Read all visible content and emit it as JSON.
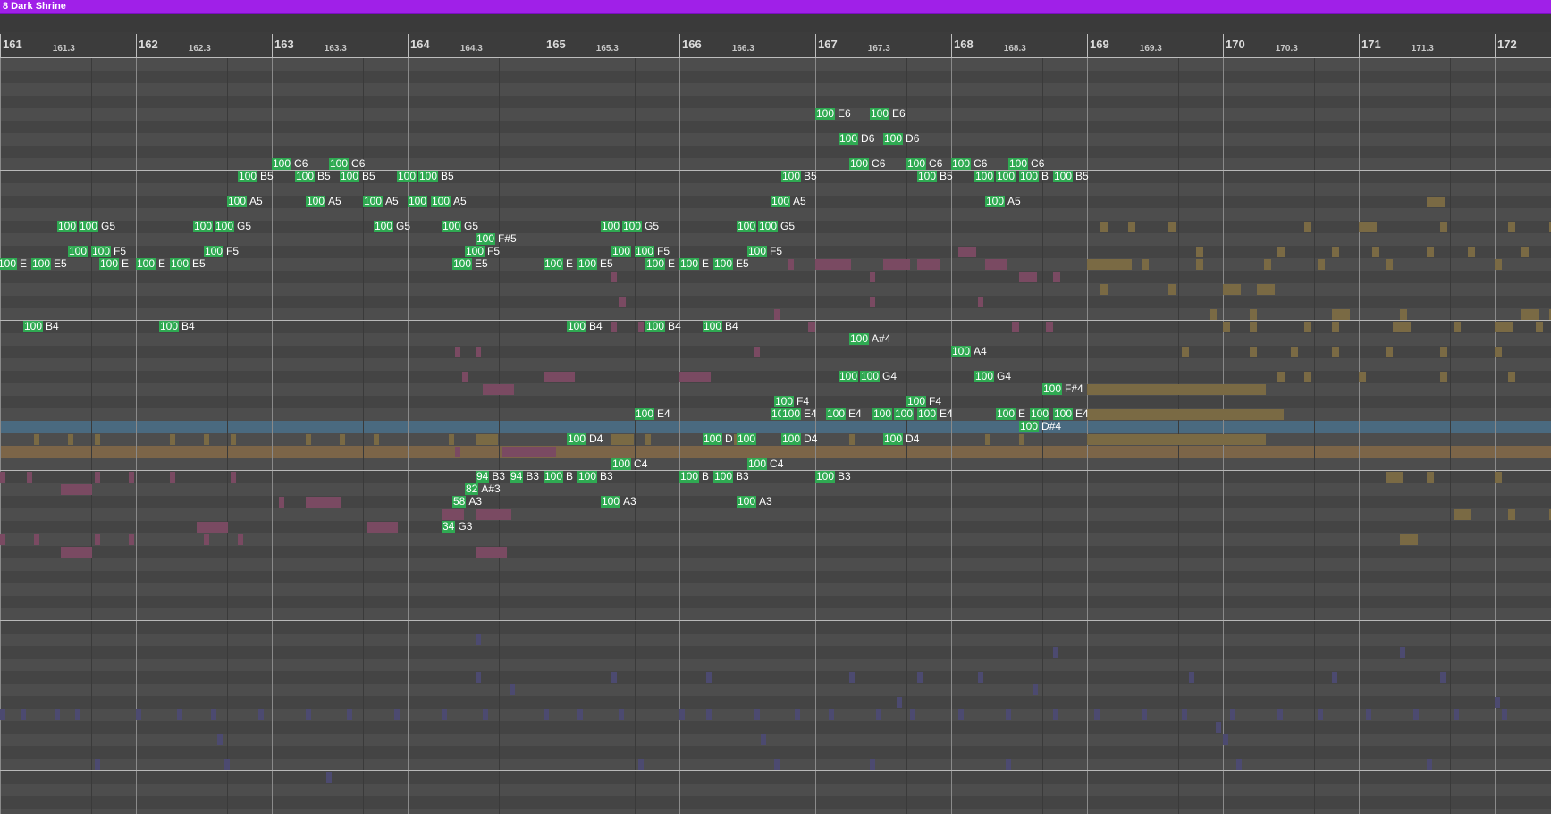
{
  "clip": {
    "title": "8 Dark Shrine",
    "color": "#a020e8"
  },
  "colors": {
    "note_fill": "#2faa52",
    "ghost_pink": "#7a4a62",
    "ghost_gold": "#7a6a44",
    "ghost_blue": "#4c4a70",
    "highlight_blue": "#4a6a80",
    "highlight_gold": "#7c6548"
  },
  "ruler": {
    "bars": [
      "161",
      "162",
      "163",
      "164",
      "165",
      "166",
      "167",
      "168",
      "169",
      "170",
      "171",
      "172"
    ],
    "subdivisions": [
      "161.3",
      "162.3",
      "163.3",
      "164.3",
      "165.3",
      "166.3",
      "167.3",
      "168.3",
      "169.3",
      "170.3",
      "171.3"
    ]
  },
  "notes": [
    {
      "vel": "100",
      "pitch": "E6",
      "bar": 167,
      "row": 4
    },
    {
      "vel": "100",
      "pitch": "E6",
      "bar": 167.4,
      "row": 4
    },
    {
      "vel": "100",
      "pitch": "D6",
      "bar": 167.17,
      "row": 6
    },
    {
      "vel": "100",
      "pitch": "D6",
      "bar": 167.5,
      "row": 6
    },
    {
      "vel": "100",
      "pitch": "C6",
      "bar": 163,
      "row": 8
    },
    {
      "vel": "100",
      "pitch": "C6",
      "bar": 163.42,
      "row": 8
    },
    {
      "vel": "100",
      "pitch": "C6",
      "bar": 167.25,
      "row": 8
    },
    {
      "vel": "100",
      "pitch": "C6",
      "bar": 167.67,
      "row": 8
    },
    {
      "vel": "100",
      "pitch": "C6",
      "bar": 168,
      "row": 8
    },
    {
      "vel": "100",
      "pitch": "C6",
      "bar": 168.42,
      "row": 8
    },
    {
      "vel": "100",
      "pitch": "B5",
      "bar": 162.75,
      "row": 9
    },
    {
      "vel": "100",
      "pitch": "B5",
      "bar": 163.17,
      "row": 9
    },
    {
      "vel": "100",
      "pitch": "B5",
      "bar": 163.5,
      "row": 9
    },
    {
      "vel": "100",
      "pitch": "",
      "bar": 163.92,
      "row": 9
    },
    {
      "vel": "100",
      "pitch": "B5",
      "bar": 164.08,
      "row": 9
    },
    {
      "vel": "100",
      "pitch": "B5",
      "bar": 166.75,
      "row": 9
    },
    {
      "vel": "100",
      "pitch": "B5",
      "bar": 167.75,
      "row": 9
    },
    {
      "vel": "100",
      "pitch": "",
      "bar": 168.17,
      "row": 9
    },
    {
      "vel": "100",
      "pitch": "",
      "bar": 168.33,
      "row": 9
    },
    {
      "vel": "100",
      "pitch": "B",
      "bar": 168.5,
      "row": 9
    },
    {
      "vel": "100",
      "pitch": "B5",
      "bar": 168.75,
      "row": 9
    },
    {
      "vel": "100",
      "pitch": "A5",
      "bar": 162.67,
      "row": 11
    },
    {
      "vel": "100",
      "pitch": "A5",
      "bar": 163.25,
      "row": 11
    },
    {
      "vel": "100",
      "pitch": "A5",
      "bar": 163.67,
      "row": 11
    },
    {
      "vel": "100",
      "pitch": "",
      "bar": 164,
      "row": 11
    },
    {
      "vel": "100",
      "pitch": "A5",
      "bar": 164.17,
      "row": 11
    },
    {
      "vel": "100",
      "pitch": "A5",
      "bar": 166.67,
      "row": 11
    },
    {
      "vel": "100",
      "pitch": "A5",
      "bar": 168.25,
      "row": 11
    },
    {
      "vel": "100",
      "pitch": "",
      "bar": 161.42,
      "row": 13
    },
    {
      "vel": "100",
      "pitch": "G5",
      "bar": 161.58,
      "row": 13
    },
    {
      "vel": "100",
      "pitch": "",
      "bar": 162.42,
      "row": 13
    },
    {
      "vel": "100",
      "pitch": "G5",
      "bar": 162.58,
      "row": 13
    },
    {
      "vel": "100",
      "pitch": "G5",
      "bar": 163.75,
      "row": 13
    },
    {
      "vel": "100",
      "pitch": "G5",
      "bar": 164.25,
      "row": 13
    },
    {
      "vel": "100",
      "pitch": "",
      "bar": 165.42,
      "row": 13
    },
    {
      "vel": "100",
      "pitch": "G5",
      "bar": 165.58,
      "row": 13
    },
    {
      "vel": "100",
      "pitch": "",
      "bar": 166.42,
      "row": 13
    },
    {
      "vel": "100",
      "pitch": "G5",
      "bar": 166.58,
      "row": 13
    },
    {
      "vel": "100",
      "pitch": "F#5",
      "bar": 164.5,
      "row": 14
    },
    {
      "vel": "100",
      "pitch": "",
      "bar": 161.5,
      "row": 15
    },
    {
      "vel": "100",
      "pitch": "F5",
      "bar": 161.67,
      "row": 15
    },
    {
      "vel": "100",
      "pitch": "F5",
      "bar": 162.5,
      "row": 15
    },
    {
      "vel": "100",
      "pitch": "F5",
      "bar": 164.42,
      "row": 15
    },
    {
      "vel": "100",
      "pitch": "",
      "bar": 165.5,
      "row": 15
    },
    {
      "vel": "100",
      "pitch": "F5",
      "bar": 165.67,
      "row": 15
    },
    {
      "vel": "100",
      "pitch": "F5",
      "bar": 166.5,
      "row": 15
    },
    {
      "vel": "100",
      "pitch": "E",
      "bar": 160.98,
      "row": 16
    },
    {
      "vel": "100",
      "pitch": "E5",
      "bar": 161.23,
      "row": 16
    },
    {
      "vel": "100",
      "pitch": "E",
      "bar": 161.73,
      "row": 16
    },
    {
      "vel": "100",
      "pitch": "E",
      "bar": 162,
      "row": 16
    },
    {
      "vel": "100",
      "pitch": "E5",
      "bar": 162.25,
      "row": 16
    },
    {
      "vel": "100",
      "pitch": "E5",
      "bar": 164.33,
      "row": 16
    },
    {
      "vel": "100",
      "pitch": "E",
      "bar": 165,
      "row": 16
    },
    {
      "vel": "100",
      "pitch": "E5",
      "bar": 165.25,
      "row": 16
    },
    {
      "vel": "100",
      "pitch": "E",
      "bar": 165.75,
      "row": 16
    },
    {
      "vel": "100",
      "pitch": "E",
      "bar": 166,
      "row": 16
    },
    {
      "vel": "100",
      "pitch": "E5",
      "bar": 166.25,
      "row": 16
    },
    {
      "vel": "100",
      "pitch": "B4",
      "bar": 161.17,
      "row": 21
    },
    {
      "vel": "100",
      "pitch": "B4",
      "bar": 162.17,
      "row": 21
    },
    {
      "vel": "100",
      "pitch": "B4",
      "bar": 165.17,
      "row": 21
    },
    {
      "vel": "100",
      "pitch": "B4",
      "bar": 165.75,
      "row": 21
    },
    {
      "vel": "100",
      "pitch": "B4",
      "bar": 166.17,
      "row": 21
    },
    {
      "vel": "100",
      "pitch": "A#4",
      "bar": 167.25,
      "row": 22
    },
    {
      "vel": "100",
      "pitch": "A4",
      "bar": 168,
      "row": 23
    },
    {
      "vel": "100",
      "pitch": "",
      "bar": 167.17,
      "row": 25
    },
    {
      "vel": "100",
      "pitch": "G4",
      "bar": 167.33,
      "row": 25
    },
    {
      "vel": "100",
      "pitch": "G4",
      "bar": 168.17,
      "row": 25
    },
    {
      "vel": "100",
      "pitch": "F#4",
      "bar": 168.67,
      "row": 26
    },
    {
      "vel": "100",
      "pitch": "F4",
      "bar": 166.7,
      "row": 27
    },
    {
      "vel": "100",
      "pitch": "F4",
      "bar": 167.67,
      "row": 27
    },
    {
      "vel": "100",
      "pitch": "E4",
      "bar": 165.67,
      "row": 28
    },
    {
      "vel": "100",
      "pitch": "",
      "bar": 166.67,
      "row": 28
    },
    {
      "vel": "100",
      "pitch": "E4",
      "bar": 166.75,
      "row": 28
    },
    {
      "vel": "100",
      "pitch": "E4",
      "bar": 167.08,
      "row": 28
    },
    {
      "vel": "100",
      "pitch": "",
      "bar": 167.42,
      "row": 28
    },
    {
      "vel": "100",
      "pitch": "",
      "bar": 167.58,
      "row": 28
    },
    {
      "vel": "100",
      "pitch": "E4",
      "bar": 167.75,
      "row": 28
    },
    {
      "vel": "100",
      "pitch": "E",
      "bar": 168.33,
      "row": 28
    },
    {
      "vel": "100",
      "pitch": "",
      "bar": 168.58,
      "row": 28
    },
    {
      "vel": "100",
      "pitch": "E4",
      "bar": 168.75,
      "row": 28
    },
    {
      "vel": "100",
      "pitch": "D#4",
      "bar": 168.5,
      "row": 29
    },
    {
      "vel": "100",
      "pitch": "D4",
      "bar": 165.17,
      "row": 30
    },
    {
      "vel": "100",
      "pitch": "D",
      "bar": 166.17,
      "row": 30
    },
    {
      "vel": "100",
      "pitch": "",
      "bar": 166.42,
      "row": 30
    },
    {
      "vel": "100",
      "pitch": "D4",
      "bar": 166.75,
      "row": 30
    },
    {
      "vel": "100",
      "pitch": "D4",
      "bar": 167.5,
      "row": 30
    },
    {
      "vel": "100",
      "pitch": "C4",
      "bar": 165.5,
      "row": 32
    },
    {
      "vel": "100",
      "pitch": "C4",
      "bar": 166.5,
      "row": 32
    },
    {
      "vel": "94",
      "pitch": "B3",
      "bar": 164.5,
      "row": 33
    },
    {
      "vel": "94",
      "pitch": "B3",
      "bar": 164.75,
      "row": 33
    },
    {
      "vel": "100",
      "pitch": "B",
      "bar": 165,
      "row": 33
    },
    {
      "vel": "100",
      "pitch": "B3",
      "bar": 165.25,
      "row": 33
    },
    {
      "vel": "100",
      "pitch": "B",
      "bar": 166,
      "row": 33
    },
    {
      "vel": "100",
      "pitch": "B3",
      "bar": 166.25,
      "row": 33
    },
    {
      "vel": "100",
      "pitch": "B3",
      "bar": 167,
      "row": 33
    },
    {
      "vel": "82",
      "pitch": "A#3",
      "bar": 164.42,
      "row": 34
    },
    {
      "vel": "58",
      "pitch": "A3",
      "bar": 164.33,
      "row": 35
    },
    {
      "vel": "100",
      "pitch": "A3",
      "bar": 165.42,
      "row": 35
    },
    {
      "vel": "100",
      "pitch": "A3",
      "bar": 166.42,
      "row": 35
    },
    {
      "vel": "34",
      "pitch": "G3",
      "bar": 164.25,
      "row": 37
    }
  ]
}
